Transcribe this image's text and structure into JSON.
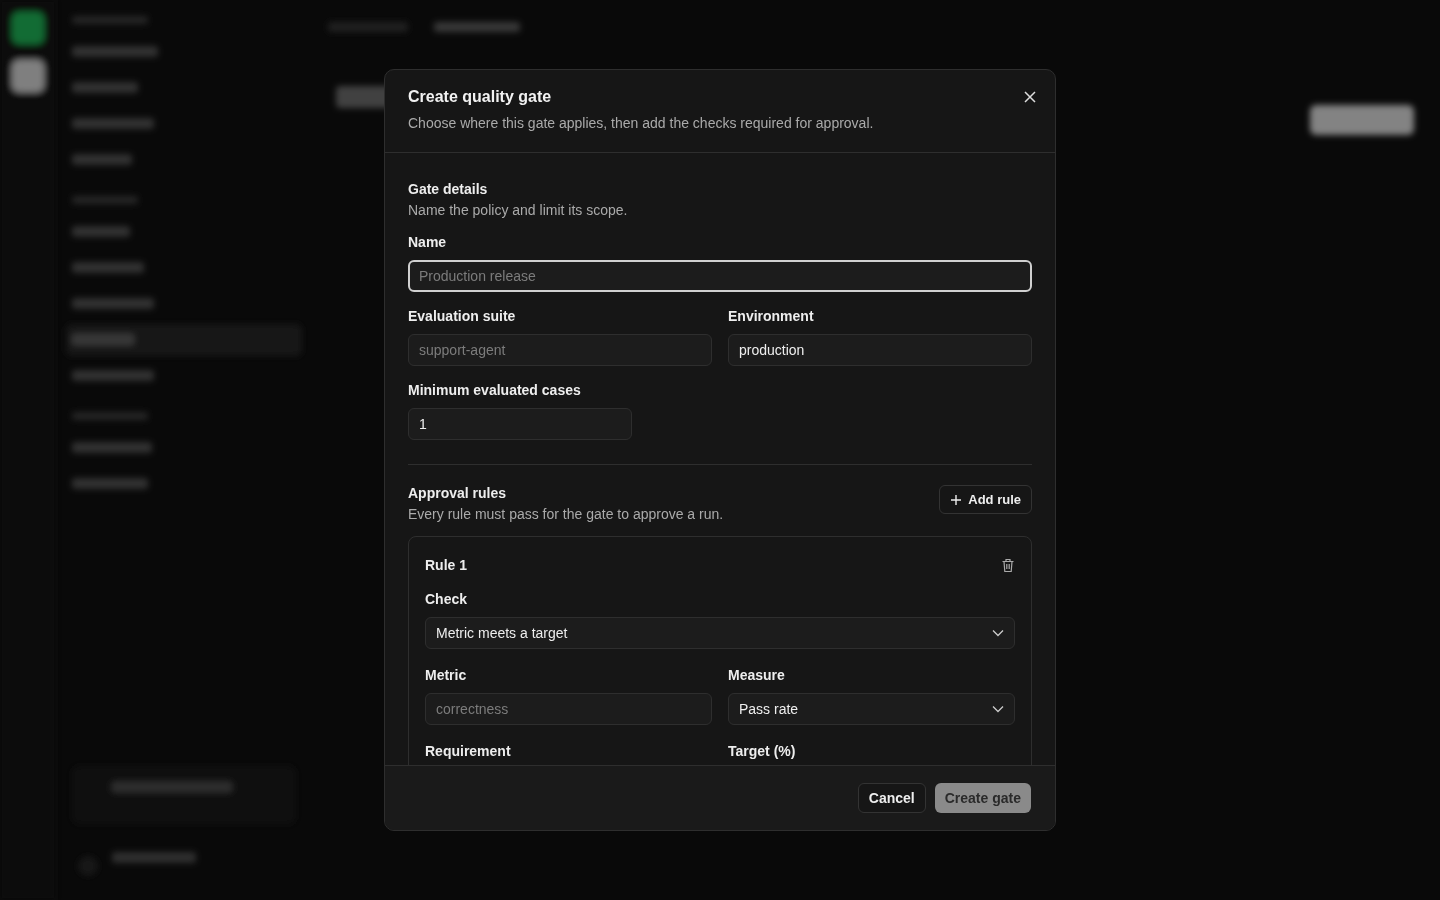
{
  "dialog": {
    "title": "Create quality gate",
    "subtitle": "Choose where this gate applies, then add the checks required for approval."
  },
  "gate_details": {
    "title": "Gate details",
    "description": "Name the policy and limit its scope.",
    "rows": [
      [
        {
          "label": "Name",
          "kind": "text",
          "placeholder": "Production release",
          "focused": true
        }
      ],
      [
        {
          "label": "Evaluation suite",
          "kind": "text",
          "placeholder": "support-agent",
          "focused": false
        },
        {
          "label": "Environment",
          "kind": "text",
          "value": "production",
          "focused": false
        }
      ],
      [
        {
          "label": "Minimum evaluated cases",
          "kind": "number",
          "value": "1",
          "focused": false
        }
      ]
    ]
  },
  "approval_rules": {
    "title": "Approval rules",
    "description": "Every rule must pass for the gate to approve a run.",
    "add_button": "Add rule",
    "rules": [
      {
        "title": "Rule 1",
        "rows": [
          [
            {
              "label": "Check",
              "kind": "select",
              "value": "Metric meets a target",
              "focused": false
            }
          ],
          [
            {
              "label": "Metric",
              "kind": "text",
              "placeholder": "correctness",
              "focused": false
            },
            {
              "label": "Measure",
              "kind": "select",
              "value": "Pass rate",
              "focused": false
            }
          ],
          [
            {
              "label": "Requirement",
              "kind": "label"
            },
            {
              "label": "Target (%)",
              "kind": "label"
            }
          ]
        ]
      }
    ]
  },
  "footer": {
    "buttons": [
      {
        "label": "Cancel",
        "kind": "secondary",
        "disabled": false
      },
      {
        "label": "Create gate",
        "kind": "primary",
        "disabled": true
      }
    ]
  }
}
